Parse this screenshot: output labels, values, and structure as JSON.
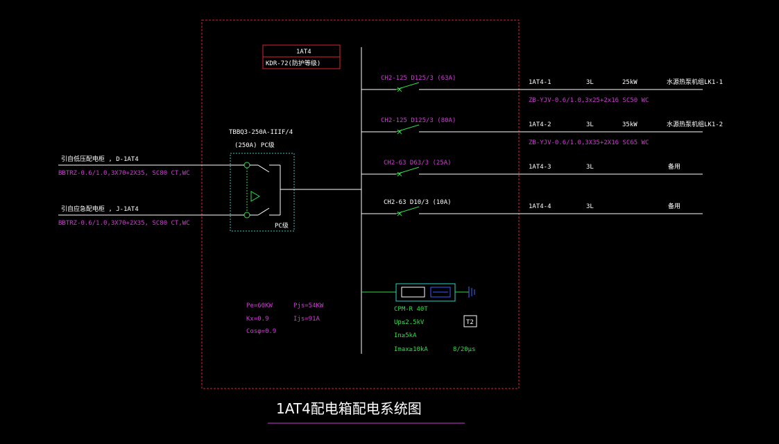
{
  "colors": {
    "background": "#000000",
    "frame": "#e0242a",
    "bus": "#ffffff",
    "text_white": "#ffffff",
    "text_magenta": "#d23bd6",
    "text_green": "#2ee04a",
    "ats_box": "#3cc9c9",
    "spd_box": "#2ad3c8",
    "spd_inner": "#3a5cff",
    "earth": "#3a6cff"
  },
  "panel": {
    "name": "1AT4",
    "model": "KDR-72(防护等级)"
  },
  "ats": {
    "model": "TBBQ3-250A-IIIF/4",
    "rating": "(250A)  PC级",
    "box_label": "PC级"
  },
  "incoming": [
    {
      "source": "引自低压配电柜 , D-1AT4",
      "cable": "BBTRZ-0.6/1.0,3X70+2X35, SC80 CT,WC"
    },
    {
      "source": "引自应急配电柜 , J-1AT4",
      "cable": "BBTRZ-0.6/1.0,3X70+2X35, SC80 CT,WC"
    }
  ],
  "loads": {
    "pe": "Pe=60KW",
    "pjs": "Pjs=54KW",
    "kx": "Kx=0.9",
    "ijs": "Ijs=91A",
    "cos": "Cosφ=0.9"
  },
  "circuits": [
    {
      "breaker": "CH2-125 D125/3 (63A)",
      "id": "1AT4-1",
      "phase": "3L",
      "power": "25kW",
      "load": "水源热泵机组LK1-1",
      "cable": "ZB-YJV-0.6/1.0,3x25+2x16 SC50 WC"
    },
    {
      "breaker": "CH2-125 D125/3 (80A)",
      "id": "1AT4-2",
      "phase": "3L",
      "power": "35kW",
      "load": "水源热泵机组LK1-2",
      "cable": "ZB-YJV-0.6/1.0,3X35+2X16 SC65 WC"
    },
    {
      "breaker": "CH2-63 D63/3 (25A)",
      "id": "1AT4-3",
      "phase": "3L",
      "power": "",
      "load": "备用",
      "cable": ""
    },
    {
      "breaker": "CH2-63 D10/3 (10A)",
      "id": "1AT4-4",
      "phase": "3L",
      "power": "",
      "load": "备用",
      "cable": ""
    }
  ],
  "spd": {
    "model": "CPM-R 40T",
    "up": "Up≤2.5kV",
    "in": "In≥5kA",
    "imax": "Imax≥10kA",
    "wave": "8/20μs",
    "class": "T2"
  },
  "title": "1AT4配电箱配电系统图"
}
